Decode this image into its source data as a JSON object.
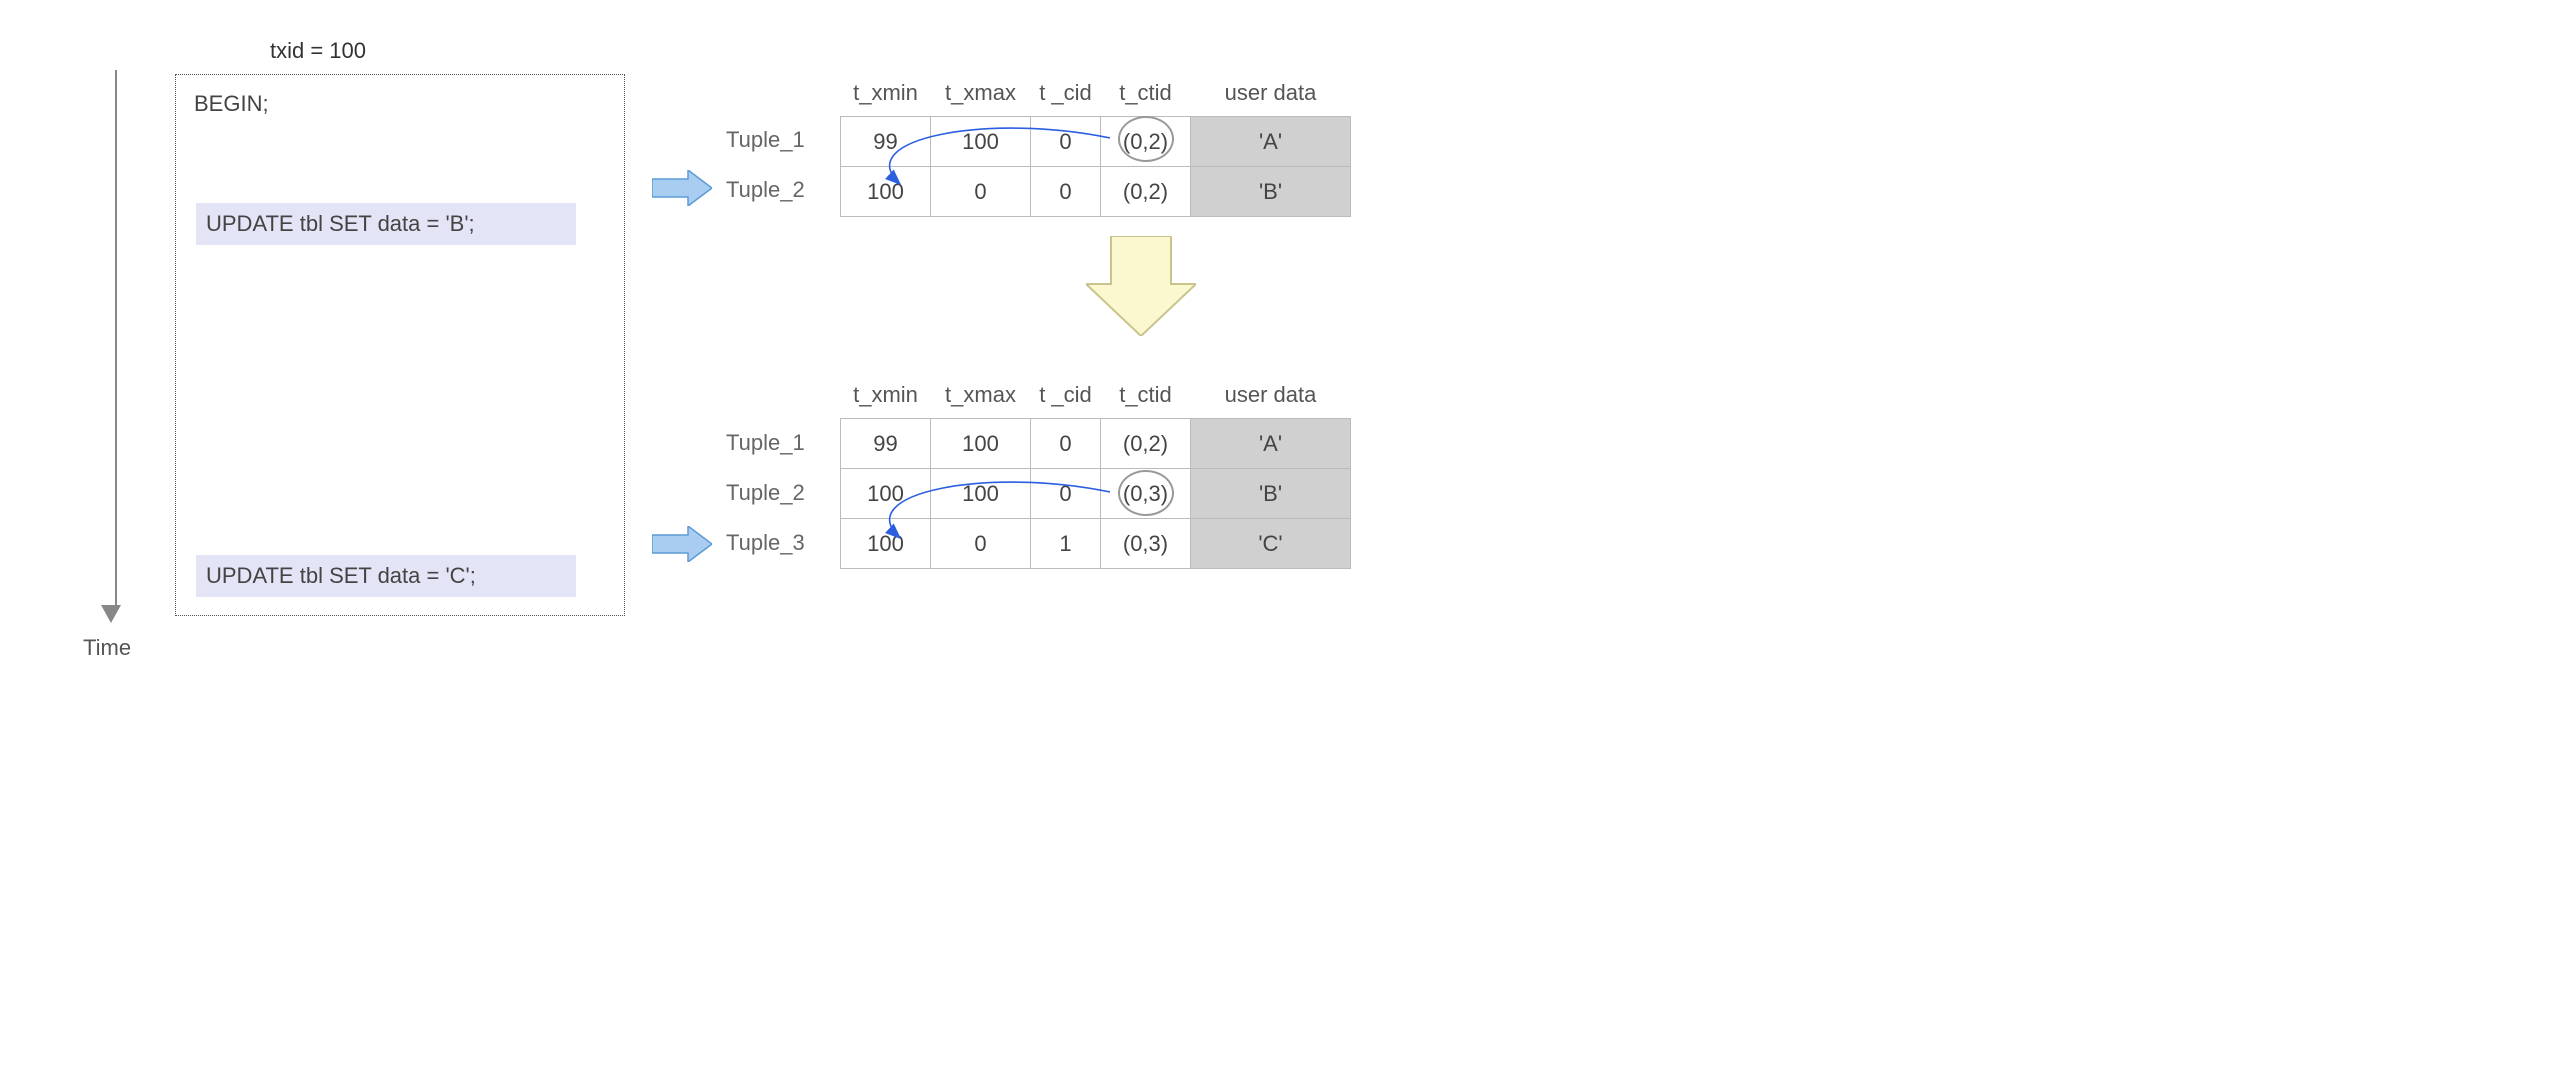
{
  "meta": {
    "txid_label": "txid = 100",
    "time_label": "Time",
    "begin": "BEGIN;"
  },
  "sql": {
    "first": "UPDATE tbl SET data = 'B';",
    "second": "UPDATE tbl SET data = 'C';"
  },
  "columns": {
    "xmin": "t_xmin",
    "xmax": "t_xmax",
    "cid": "t _cid",
    "ctid": "t_ctid",
    "user": "user data"
  },
  "table1": {
    "labels": [
      "Tuple_1",
      "Tuple_2"
    ],
    "rows": [
      {
        "xmin": "99",
        "xmax": "100",
        "cid": "0",
        "ctid": "(0,2)",
        "user": "'A'"
      },
      {
        "xmin": "100",
        "xmax": "0",
        "cid": "0",
        "ctid": "(0,2)",
        "user": "'B'"
      }
    ]
  },
  "table2": {
    "labels": [
      "Tuple_1",
      "Tuple_2",
      "Tuple_3"
    ],
    "rows": [
      {
        "xmin": "99",
        "xmax": "100",
        "cid": "0",
        "ctid": "(0,2)",
        "user": "'A'"
      },
      {
        "xmin": "100",
        "xmax": "100",
        "cid": "0",
        "ctid": "(0,3)",
        "user": "'B'"
      },
      {
        "xmin": "100",
        "xmax": "0",
        "cid": "1",
        "ctid": "(0,3)",
        "user": "'C'"
      }
    ]
  },
  "chart_data": {
    "type": "table",
    "title": "Tuple header evolution under txid 100 (two UPDATEs)",
    "states": [
      {
        "after": "UPDATE tbl SET data = 'B';",
        "columns": [
          "t_xmin",
          "t_xmax",
          "t_cid",
          "t_ctid",
          "user data"
        ],
        "tuples": [
          {
            "name": "Tuple_1",
            "t_xmin": 99,
            "t_xmax": 100,
            "t_cid": 0,
            "t_ctid": "(0,2)",
            "user_data": "A"
          },
          {
            "name": "Tuple_2",
            "t_xmin": 100,
            "t_xmax": 0,
            "t_cid": 0,
            "t_ctid": "(0,2)",
            "user_data": "B"
          }
        ],
        "ctid_link": {
          "from": "Tuple_1",
          "to": "Tuple_2"
        }
      },
      {
        "after": "UPDATE tbl SET data = 'C';",
        "columns": [
          "t_xmin",
          "t_xmax",
          "t_cid",
          "t_ctid",
          "user data"
        ],
        "tuples": [
          {
            "name": "Tuple_1",
            "t_xmin": 99,
            "t_xmax": 100,
            "t_cid": 0,
            "t_ctid": "(0,2)",
            "user_data": "A"
          },
          {
            "name": "Tuple_2",
            "t_xmin": 100,
            "t_xmax": 100,
            "t_cid": 0,
            "t_ctid": "(0,3)",
            "user_data": "B"
          },
          {
            "name": "Tuple_3",
            "t_xmin": 100,
            "t_xmax": 0,
            "t_cid": 1,
            "t_ctid": "(0,3)",
            "user_data": "C"
          }
        ],
        "ctid_link": {
          "from": "Tuple_2",
          "to": "Tuple_3"
        }
      }
    ]
  }
}
